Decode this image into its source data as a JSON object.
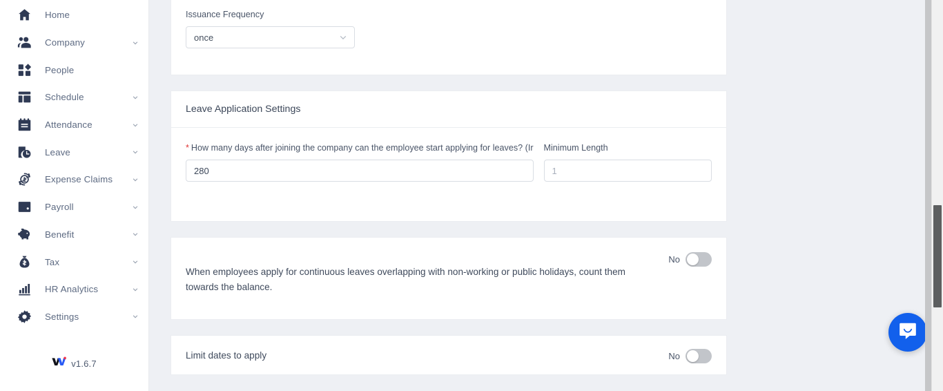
{
  "sidebar": {
    "items": [
      {
        "label": "Home",
        "icon": "home-icon",
        "has_chevron": false
      },
      {
        "label": "Company",
        "icon": "people-group-icon",
        "has_chevron": true
      },
      {
        "label": "People",
        "icon": "grid-shapes-icon",
        "has_chevron": false
      },
      {
        "label": "Schedule",
        "icon": "layout-icon",
        "has_chevron": true
      },
      {
        "label": "Attendance",
        "icon": "clipboard-icon",
        "has_chevron": true
      },
      {
        "label": "Leave",
        "icon": "clock-calendar-icon",
        "has_chevron": true
      },
      {
        "label": "Expense Claims",
        "icon": "coin-refresh-icon",
        "has_chevron": true
      },
      {
        "label": "Payroll",
        "icon": "wallet-icon",
        "has_chevron": true
      },
      {
        "label": "Benefit",
        "icon": "piggy-bank-icon",
        "has_chevron": true
      },
      {
        "label": "Tax",
        "icon": "money-bag-icon",
        "has_chevron": true
      },
      {
        "label": "HR Analytics",
        "icon": "bar-chart-icon",
        "has_chevron": true
      },
      {
        "label": "Settings",
        "icon": "gear-icon",
        "has_chevron": true
      }
    ],
    "version": "v1.6.7",
    "logo_icon": "workstem-w-logo"
  },
  "main": {
    "issuance_card": {
      "frequency_label": "Issuance Frequency",
      "frequency_value": "once",
      "frequency_chevron_icon": "chevron-down-icon"
    },
    "leave_application_card": {
      "title": "Leave Application Settings",
      "days_label": "How many days after joining the company can the employee start applying for leaves? (Ir",
      "days_required_marker": "*",
      "days_value": "280",
      "min_length_label": "Minimum Length",
      "min_length_value": "1"
    },
    "holiday_toggle_card": {
      "text": "When employees apply for continuous leaves overlapping with non-working or public holidays, count them towards the balance.",
      "toggle_label": "No",
      "toggle_state": "off"
    },
    "limit_dates_card": {
      "text": "Limit dates to apply",
      "toggle_label": "No",
      "toggle_state": "off"
    }
  },
  "widgets": {
    "intercom_icon": "chat-bubble-smile-icon"
  },
  "colors": {
    "accent_blue": "#1260ec",
    "required_red": "#e03131",
    "sidebar_icon": "#2f3a54",
    "page_bg": "#eef0f4"
  }
}
